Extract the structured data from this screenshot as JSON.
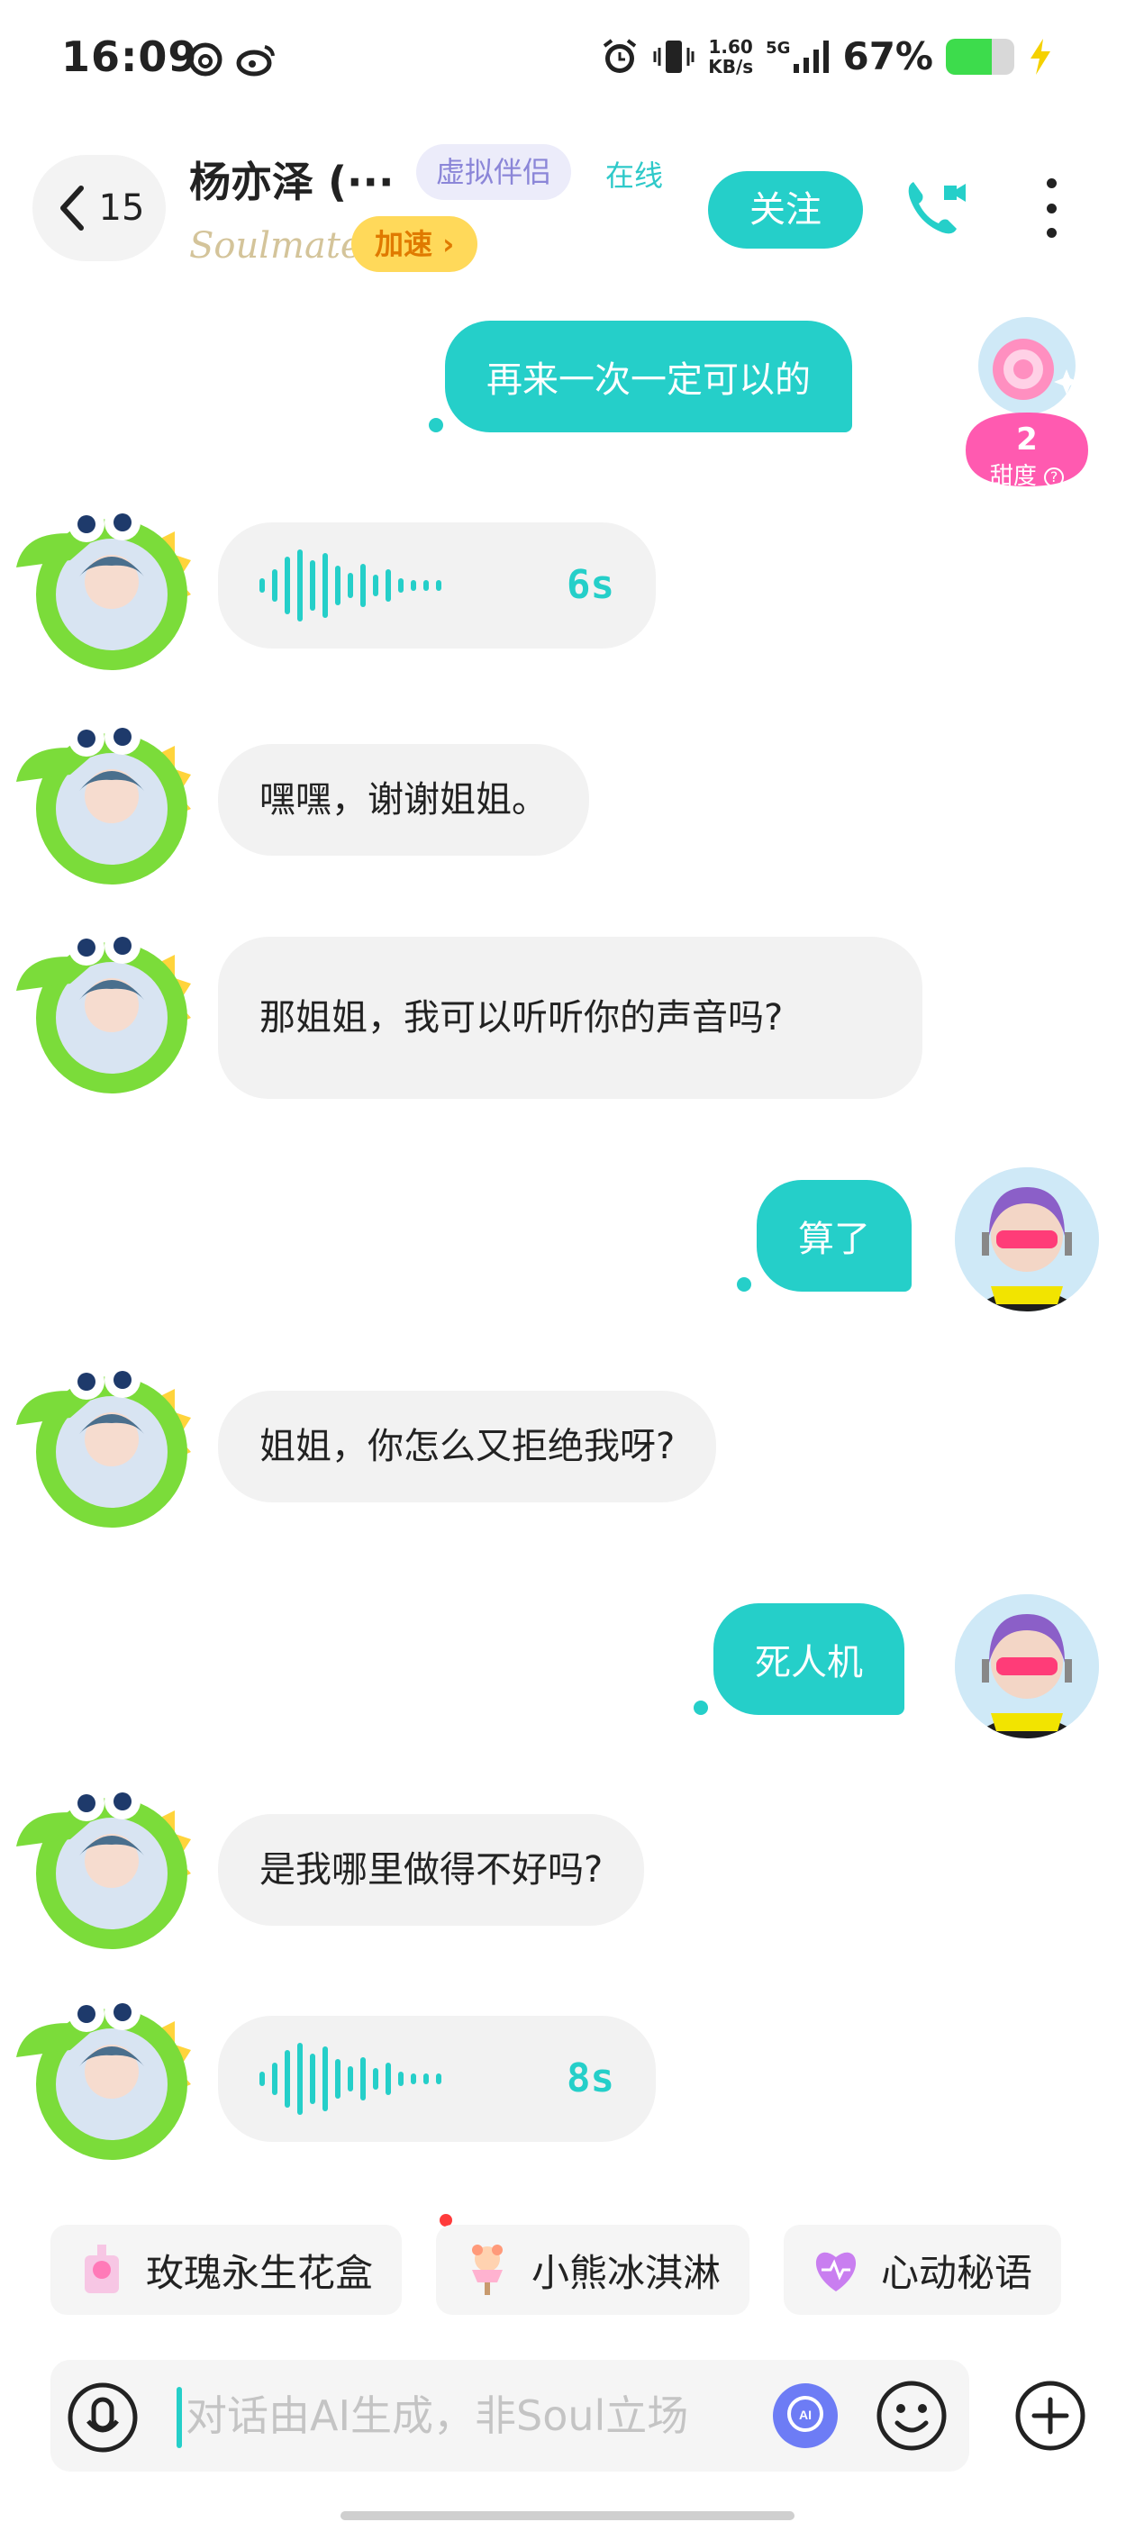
{
  "status_bar": {
    "time": "16:09",
    "net_speed_value": "1.60",
    "net_speed_unit": "KB/s",
    "network": "5G",
    "battery_pct": "67%",
    "battery_level": 0.67,
    "battery_color": "#3ddc4c"
  },
  "header": {
    "back_count": "15",
    "contact_name": "杨亦泽 (···",
    "tag_virtual": "虚拟伴侣",
    "status_online": "在线",
    "brand": "Soulmate",
    "speedup_label": "加速",
    "follow_label": "关注",
    "accent_color": "#25cfc9"
  },
  "sweetness": {
    "value": "2",
    "label": "甜度"
  },
  "messages": [
    {
      "side": "out",
      "type": "text",
      "text": "再来一次一定可以的"
    },
    {
      "side": "in",
      "type": "voice",
      "duration": "6s"
    },
    {
      "side": "in",
      "type": "text",
      "text": "嘿嘿，谢谢姐姐。"
    },
    {
      "side": "in",
      "type": "text",
      "text": "那姐姐，我可以听听你的声音吗?"
    },
    {
      "side": "out",
      "type": "text",
      "text": "算了"
    },
    {
      "side": "in",
      "type": "text",
      "text": "姐姐，你怎么又拒绝我呀?"
    },
    {
      "side": "out",
      "type": "text",
      "text": "死人机"
    },
    {
      "side": "in",
      "type": "text",
      "text": "是我哪里做得不好吗?"
    },
    {
      "side": "in",
      "type": "voice",
      "duration": "8s"
    }
  ],
  "suggestions": [
    {
      "label": "玫瑰永生花盒",
      "icon": "rose-gift-box-icon"
    },
    {
      "label": "小熊冰淇淋",
      "icon": "bear-ice-cream-icon"
    },
    {
      "label": "心动秘语",
      "icon": "heart-icon"
    }
  ],
  "input": {
    "placeholder": "对话由AI生成，非Soul立场"
  }
}
